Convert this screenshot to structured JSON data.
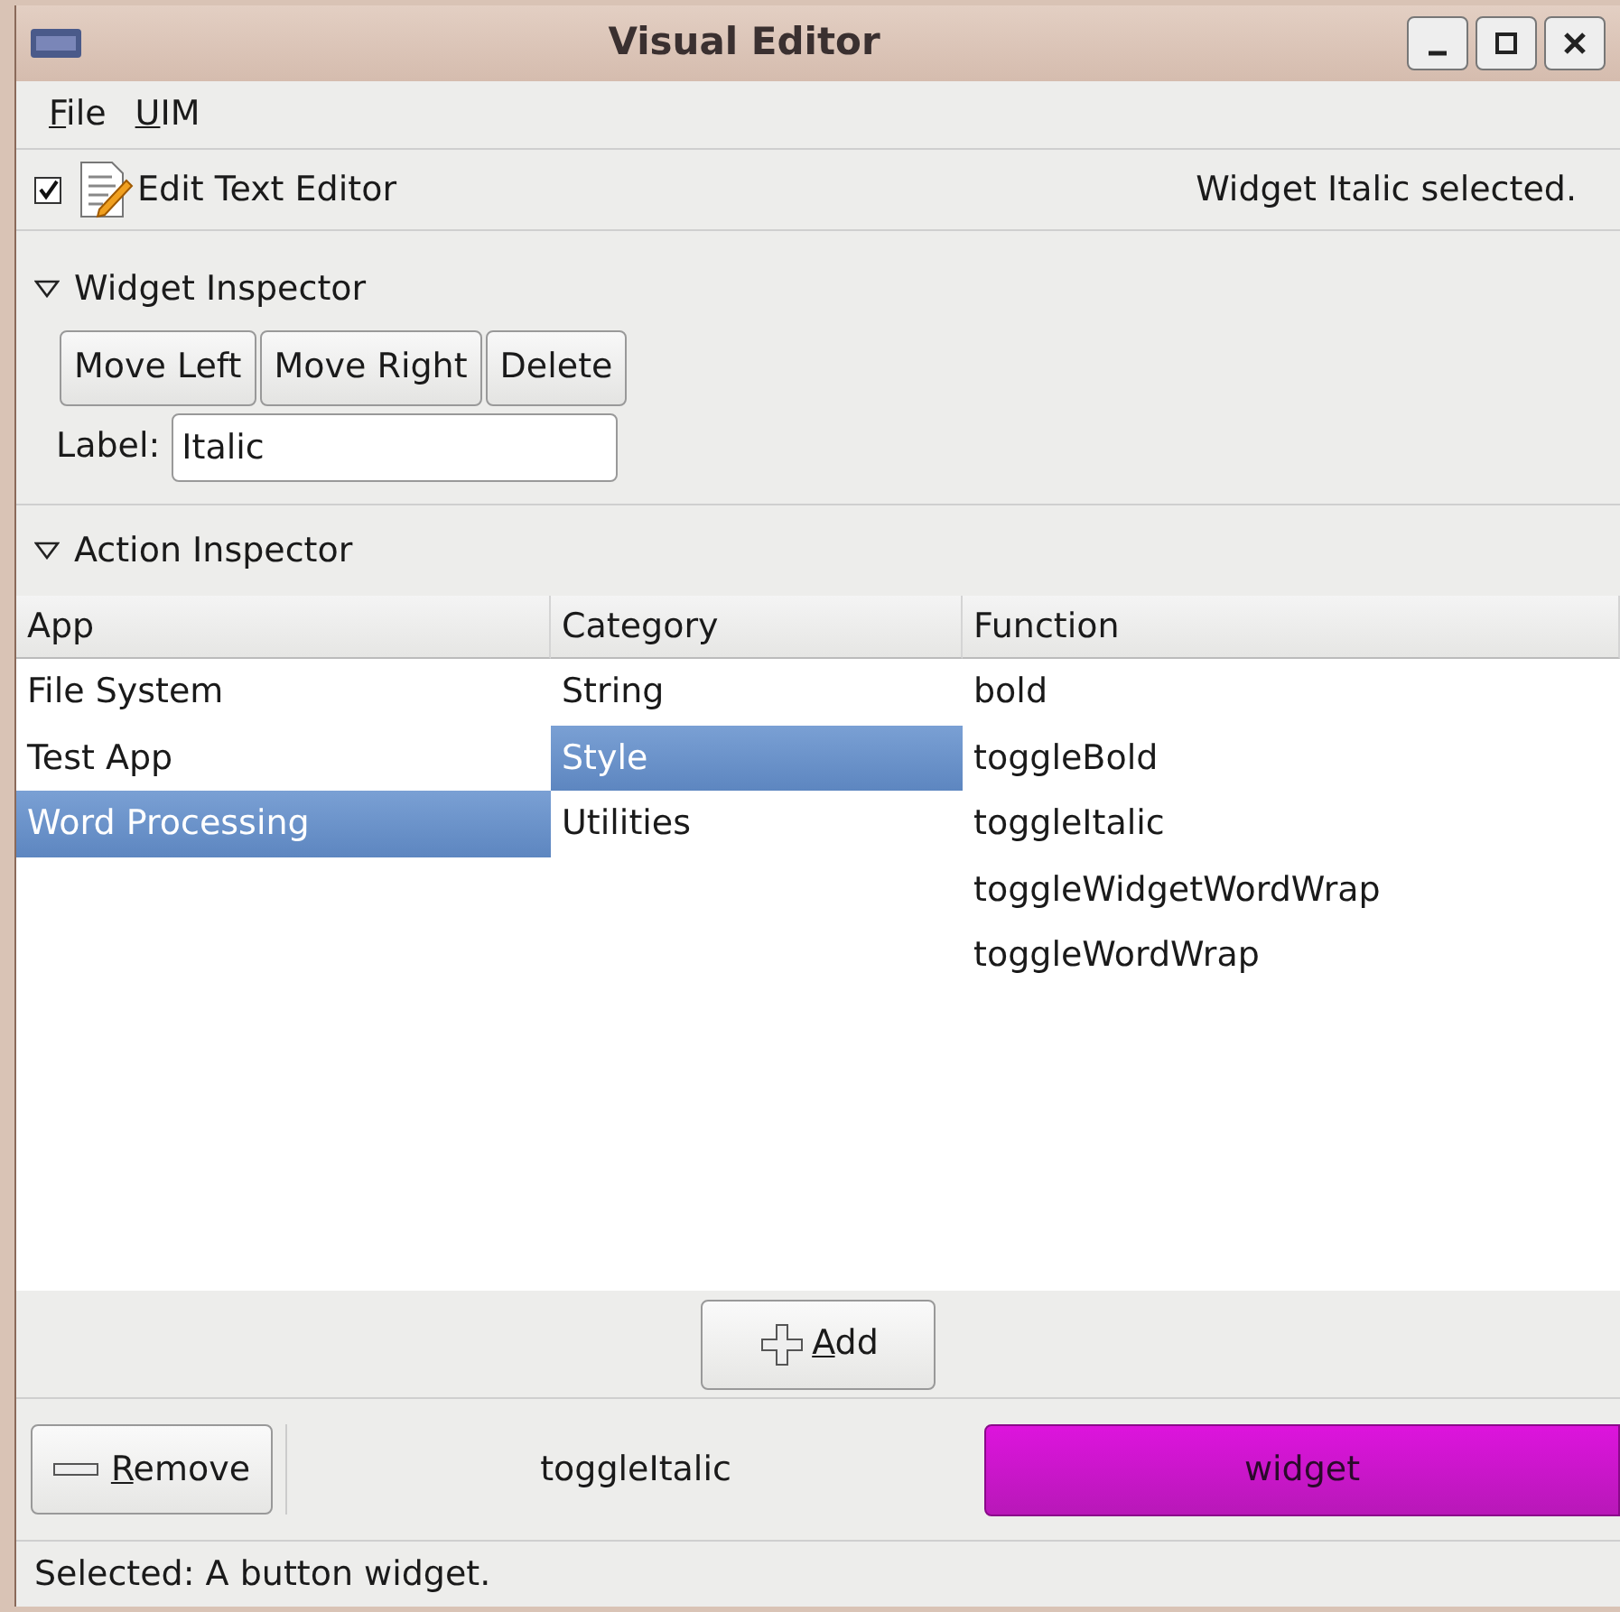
{
  "window": {
    "title": "Visual Editor"
  },
  "menu": [
    "File",
    "UIM"
  ],
  "toolbar": {
    "checkbox": {
      "checked": true
    },
    "label": "Edit Text Editor",
    "status": "Widget Italic selected."
  },
  "widget_inspector": {
    "title": "Widget Inspector",
    "expanded": true,
    "buttons": [
      "Move Left",
      "Move Right",
      "Delete"
    ],
    "field_label": "Label:",
    "field_value": "Italic"
  },
  "action_inspector": {
    "title": "Action Inspector",
    "expanded": true,
    "columns": [
      {
        "header": "App",
        "items": [
          {
            "label": "File System",
            "selected": false
          },
          {
            "label": "Test App",
            "selected": false
          },
          {
            "label": "Word Processing",
            "selected": true
          }
        ]
      },
      {
        "header": "Category",
        "items": [
          {
            "label": "String",
            "selected": false
          },
          {
            "label": "Style",
            "selected": true
          },
          {
            "label": "Utilities",
            "selected": false
          }
        ]
      },
      {
        "header": "Function",
        "items": [
          {
            "label": "bold",
            "selected": false
          },
          {
            "label": "toggleBold",
            "selected": false
          },
          {
            "label": "toggleItalic",
            "selected": false
          },
          {
            "label": "toggleWidgetWordWrap",
            "selected": false
          },
          {
            "label": "toggleWordWrap",
            "selected": false
          }
        ]
      }
    ],
    "add_button": "Add"
  },
  "bottom": {
    "remove_button": "Remove",
    "function_label": "toggleItalic",
    "widget_button": "widget"
  },
  "status_bar": "Selected: A button widget."
}
